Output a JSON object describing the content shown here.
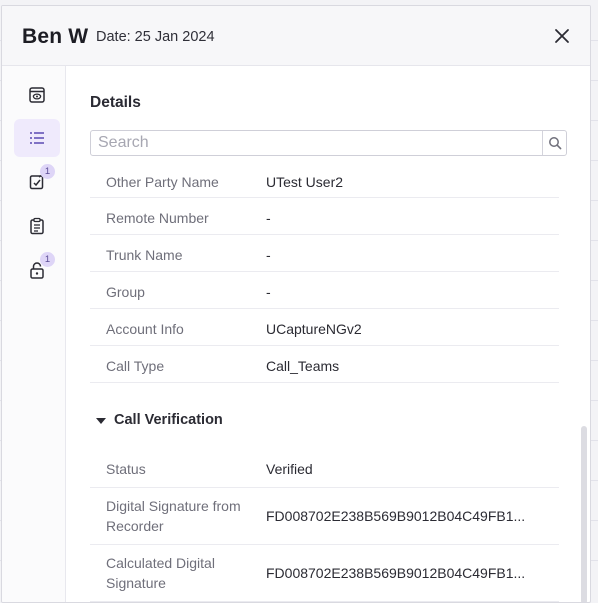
{
  "header": {
    "title": "Ben W",
    "date": "Date: 25 Jan 2024"
  },
  "rail": {
    "items": [
      {
        "icon": "preview-icon",
        "active": false,
        "badge": ""
      },
      {
        "icon": "list-icon",
        "active": true,
        "badge": ""
      },
      {
        "icon": "edit-note-icon",
        "active": false,
        "badge": "1"
      },
      {
        "icon": "clipboard-icon",
        "active": false,
        "badge": ""
      },
      {
        "icon": "lock-icon",
        "active": false,
        "badge": "1"
      }
    ]
  },
  "details": {
    "title": "Details",
    "search": {
      "placeholder": "Search",
      "value": ""
    },
    "rows": [
      {
        "label": "Other Party Name",
        "value": "UTest User2"
      },
      {
        "label": "Remote Number",
        "value": "-"
      },
      {
        "label": "Trunk Name",
        "value": "-"
      },
      {
        "label": "Group",
        "value": "-"
      },
      {
        "label": "Account Info",
        "value": "UCaptureNGv2"
      },
      {
        "label": "Call Type",
        "value": "Call_Teams"
      }
    ],
    "verification": {
      "title": "Call Verification",
      "rows": [
        {
          "label": "Status",
          "value": "Verified"
        },
        {
          "label": "Digital Signature from Recorder",
          "value": "FD008702E238B569B9012B04C49FB1..."
        },
        {
          "label": "Calculated Digital Signature",
          "value": "FD008702E238B569B9012B04C49FB1..."
        }
      ]
    }
  },
  "colors": {
    "accent": "#efeafc",
    "badge": "#ded5f7",
    "label": "#6f6f7a",
    "text": "#2b2b33"
  }
}
